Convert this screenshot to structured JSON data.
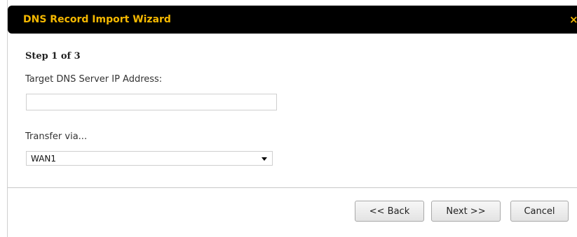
{
  "dialog": {
    "title": "DNS Record Import Wizard",
    "close_icon": "close-icon",
    "close_glyph": "×"
  },
  "form": {
    "step": "Step 1 of 3",
    "ip_label": "Target DNS Server IP Address:",
    "ip_value": "",
    "ip_placeholder": "",
    "transfer_label": "Transfer via...",
    "transfer_selected": "WAN1"
  },
  "buttons": {
    "back": "<< Back",
    "next": "Next >>",
    "cancel": "Cancel"
  },
  "colors": {
    "title_bar": "#000000",
    "title_text": "#f5b800"
  }
}
